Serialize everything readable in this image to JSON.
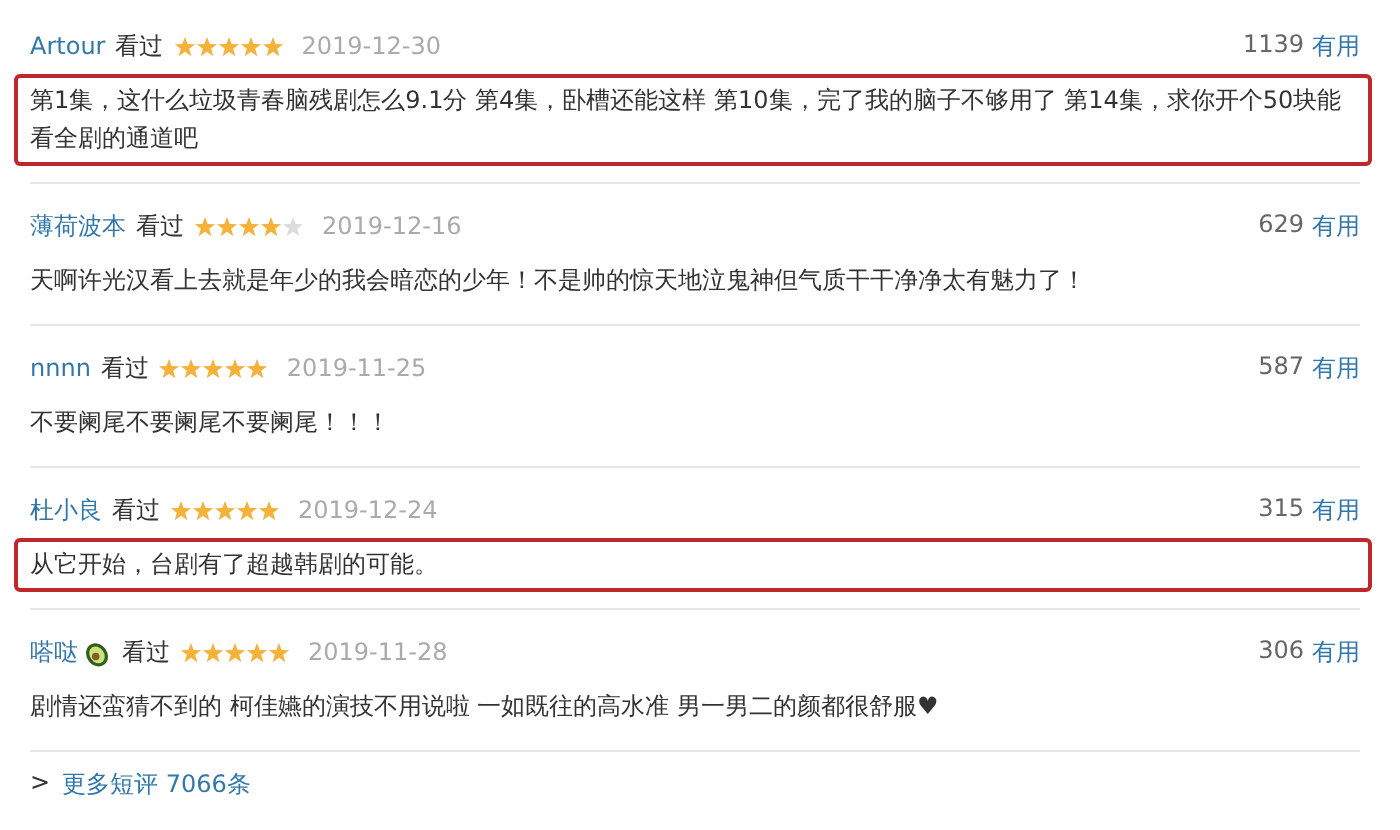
{
  "reviews": [
    {
      "kind": "plain",
      "user": "Artour",
      "status": "看过",
      "stars": 5,
      "date": "2019-12-30",
      "votes": "1139",
      "vote_label": "有用",
      "text": "第1集，这什么垃圾青春脑残剧怎么9.1分 第4集，卧槽还能这样 第10集，完了我的脑子不够用了 第14集，求你开个50块能看全剧的通道吧",
      "highlighted": true
    },
    {
      "kind": "plain",
      "user": "薄荷波本",
      "status": "看过",
      "stars": 4,
      "date": "2019-12-16",
      "votes": "629",
      "vote_label": "有用",
      "text": "天啊许光汉看上去就是年少的我会暗恋的少年！不是帅的惊天地泣鬼神但气质干干净净太有魅力了！",
      "highlighted": false
    },
    {
      "kind": "plain",
      "user": "nnnn",
      "status": "看过",
      "stars": 5,
      "date": "2019-11-25",
      "votes": "587",
      "vote_label": "有用",
      "text": "不要阑尾不要阑尾不要阑尾！！！",
      "highlighted": false
    },
    {
      "kind": "plain",
      "user": "杜小良",
      "status": "看过",
      "stars": 5,
      "date": "2019-12-24",
      "votes": "315",
      "vote_label": "有用",
      "text": "从它开始，台剧有了超越韩剧的可能。",
      "highlighted": true
    },
    {
      "kind": "emoji",
      "user": "嗒哒",
      "status": "看过",
      "stars": 5,
      "date": "2019-11-28",
      "votes": "306",
      "vote_label": "有用",
      "text": "剧情还蛮猜不到的 柯佳嬿的演技不用说啦 一如既往的高水准 男一男二的颜都很舒服♥",
      "highlighted": false
    }
  ],
  "more": {
    "arrow": ">",
    "label": "更多短评 7066条"
  }
}
